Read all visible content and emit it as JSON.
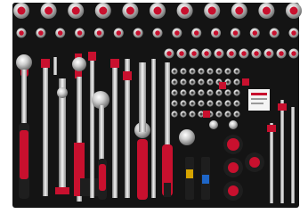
{
  "photo": {
    "subject": "socket-and-ratchet-tool-tray",
    "colors": {
      "background": "#ffffff",
      "tray_foam": "#141414",
      "accent_red": "#c8102e",
      "chrome_light": "#e6e6e6",
      "chrome_dark": "#8a8a8a",
      "handle_black": "#1e1e1e"
    },
    "socket_rows": [
      {
        "count": 11,
        "kind": "large-socket"
      },
      {
        "count": 15,
        "kind": "medium-socket"
      },
      {
        "count": 11,
        "kind": "small-socket"
      }
    ],
    "tools": [
      "ratchet-large",
      "extension-bar",
      "t-bar",
      "ratchet-medium",
      "extension-bar",
      "ratchet-small",
      "extension-bar",
      "ratchet-quarter-drive",
      "screwdriver-adapter",
      "bit-holder"
    ],
    "label_card": "parts-card"
  }
}
